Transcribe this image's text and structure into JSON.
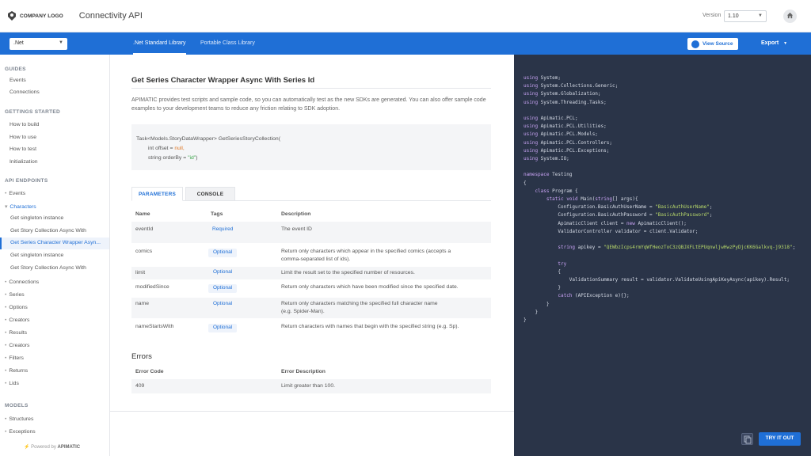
{
  "header": {
    "logo_text": "COMPANY LOGO",
    "title": "Connectivity API",
    "version_label": "Version",
    "version_value": "1.10"
  },
  "nav": {
    "language": ".Net",
    "tabs": [
      ".Net Standard Library",
      "Portable Class Library"
    ],
    "view_source": "View Source",
    "export": "Export"
  },
  "sidebar": {
    "guides_heading": "GUIDES",
    "guides": [
      "Events",
      "Connections"
    ],
    "getting_started_heading": "GETTINGS STARTED",
    "getting_started": [
      "How to build",
      "How to use",
      "How to test",
      "Initialization"
    ],
    "api_heading": "API ENDPOINTS",
    "api_events": "Events",
    "api_characters": "Characters",
    "characters_sub": [
      "Get singleton instance",
      "Get Story Collection Async With",
      "Get Series Character Wrapper Asyn...",
      "Get singleton instance",
      "Get Story Collection Async With"
    ],
    "api_rest": [
      "Connections",
      "Series",
      "Options",
      "Creators",
      "Results",
      "Creators",
      "Filters",
      "Returns",
      "Lids"
    ],
    "models_heading": "MODELS",
    "models": [
      "Structures",
      "Exceptions"
    ],
    "powered_prefix": "Powered by",
    "powered_brand": "APIMATIC"
  },
  "main": {
    "title": "Get Series Character Wrapper Async With Series Id",
    "intro": "APIMATIC provides test scripts and sample code, so you can automatically test as the new SDKs are generated. You can also offer sample code examples to your development teams to reduce any friction relating to SDK adoption.",
    "signature": {
      "line1": "Task<Models.StoryDataWrapper> GetSeriesStoryCollection(",
      "line2_prefix": "int offset = ",
      "line2_value": "null,",
      "line3_prefix": "string orderBy = ",
      "line3_value": "\"id\"",
      "line3_suffix": ")"
    },
    "tabs": {
      "parameters": "PARAMETERS",
      "console": "CONSOLE"
    },
    "param_headers": {
      "name": "Name",
      "tags": "Tags",
      "description": "Description"
    },
    "params": [
      {
        "name": "eventId",
        "tag": "Required",
        "desc": "The event ID"
      },
      {
        "name": "comics",
        "tag": "Optional",
        "desc": "Return only characters which appear in the specified comics (accepts a",
        "desc2": "comma-separated list of ids)."
      },
      {
        "name": "limit",
        "tag": "Optional",
        "desc": "Limit the result set to the specified number of resources."
      },
      {
        "name": "modifiedSince",
        "tag": "Optional",
        "desc": "Return only characters which have been modified since the specified date."
      },
      {
        "name": "name",
        "tag": "Optional",
        "desc": "Return only characters matching the specified full character name",
        "desc2": "(e.g. Spider-Man)."
      },
      {
        "name": "nameStartsWith",
        "tag": "Optional",
        "desc": "Return characters with names that begin with the specified string (e.g. Sp)."
      }
    ],
    "errors_title": "Errors",
    "error_headers": {
      "code": "Error Code",
      "description": "Error Description"
    },
    "errors": [
      {
        "code": "409",
        "desc": "Limit greater than 100."
      }
    ]
  },
  "code": {
    "lines": [
      "using System;",
      "using System.Collections.Generic;",
      "using System.Globalization;",
      "using System.Threading.Tasks;",
      "",
      "using Apimatic.PCL;",
      "using Apimatic.PCL.Utilities;",
      "using Apimatic.PCL.Models;",
      "using Apimatic.PCL.Controllers;",
      "using Apimatic.PCL.Exceptions;",
      "using System.IO;",
      "",
      "namespace Testing",
      "{",
      "    class Program {",
      "        static void Main(string[] args){",
      "            Configuration.BasicAuthUserName = \"BasicAuthUserName\";",
      "            Configuration.BasicAuthPassword = \"BasicAuthPassword\";",
      "            ApimaticClient client = new ApimaticClient();",
      "            ValidatorController validator = client.Validator;",
      "",
      "            string apikey = \"QEWbzIcps4rmYqWfHeozToC3zQBJXFLtEPUqnwljwHwzPyDjcKK6Galkvq-j9318\";",
      "",
      "            try",
      "            {",
      "                ValidationSummary result = validator.ValidateUsingApiKeyAsync(apikey).Result;",
      "            }",
      "            catch (APIException e){};",
      "        }",
      "    }",
      "}"
    ],
    "try_button": "TRY IT OUT"
  }
}
